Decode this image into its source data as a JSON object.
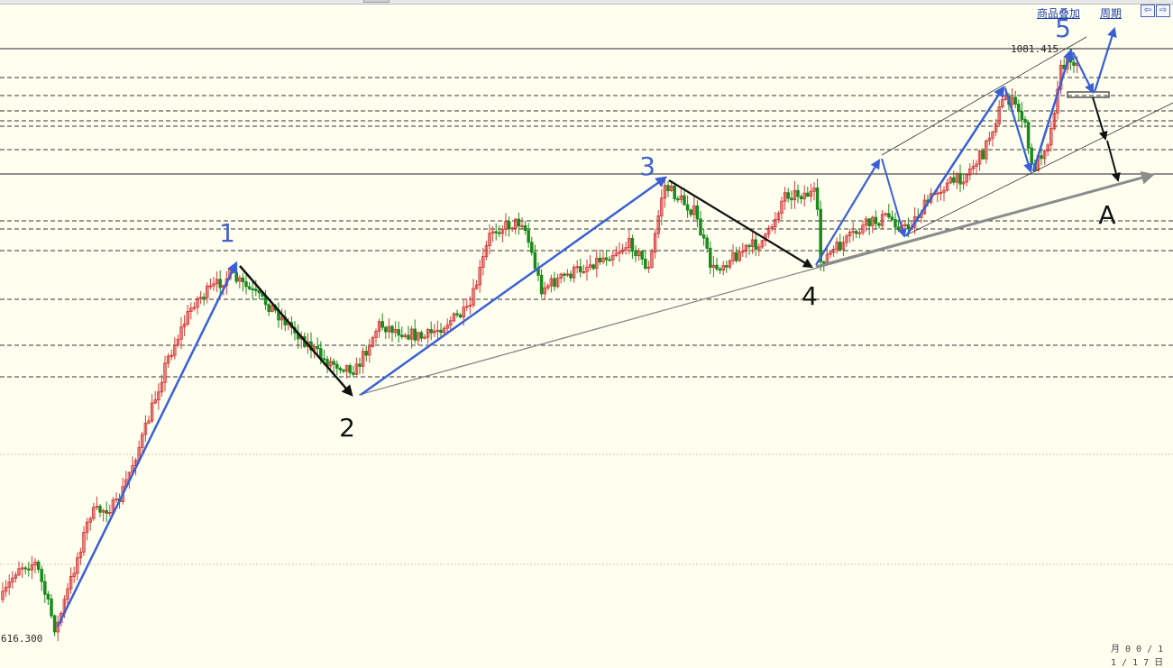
{
  "toolbar": {
    "overlay_label": "商品叠加",
    "period_label": "周期",
    "prev_icon": "arrow-left-icon",
    "next_icon": "arrow-right-icon"
  },
  "colors": {
    "background": "#fffff0",
    "impulse_wave": "#3a5fd8",
    "corrective_wave": "#111111",
    "trendline": "#8c8c8c",
    "candle_up": "#d63a3a",
    "candle_down": "#1a8a1a"
  },
  "chart_data": {
    "type": "candlestick",
    "title": "",
    "price_labels": {
      "high": "1081.415",
      "low": "616.300"
    },
    "high_value": 1081.415,
    "low_value": 616.3,
    "wave_labels": [
      {
        "label": "1",
        "color": "blue"
      },
      {
        "label": "2",
        "color": "black"
      },
      {
        "label": "3",
        "color": "blue"
      },
      {
        "label": "4",
        "color": "black"
      },
      {
        "label": "5",
        "color": "blue"
      },
      {
        "label": "A",
        "color": "black"
      }
    ],
    "bottom_text": "月 0 0 / 1 1 / 1 7 日"
  }
}
